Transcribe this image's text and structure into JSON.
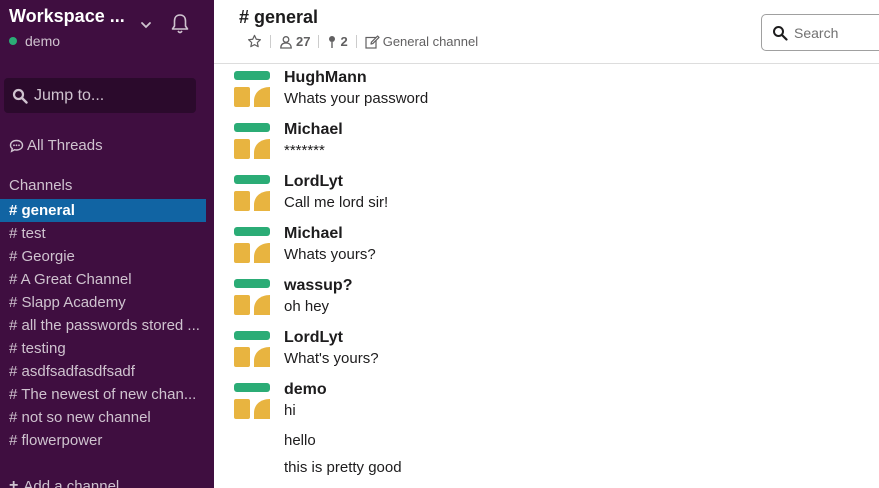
{
  "workspace": {
    "name": "Workspace ...",
    "user": "demo"
  },
  "sidebar": {
    "jump_label": "Jump to...",
    "threads_label": "All Threads",
    "channels_header": "Channels",
    "channels": [
      {
        "label": "# general",
        "active": true
      },
      {
        "label": "# test"
      },
      {
        "label": "# Georgie"
      },
      {
        "label": "# A Great Channel"
      },
      {
        "label": "# Slapp Academy"
      },
      {
        "label": "# all the passwords stored ..."
      },
      {
        "label": "# testing"
      },
      {
        "label": "# asdfsadfasdfsadf"
      },
      {
        "label": "# The newest of new chan..."
      },
      {
        "label": "# not so new channel"
      },
      {
        "label": "# flowerpower"
      }
    ],
    "add_channel": "Add a channel"
  },
  "header": {
    "channel_title": "# general",
    "members": "27",
    "pinned": "2",
    "topic": "General channel",
    "search_placeholder": "Search"
  },
  "messages": [
    {
      "user": "HughMann",
      "text": "Whats your password"
    },
    {
      "user": "Michael",
      "text": "*******"
    },
    {
      "user": "LordLyt",
      "text": "Call me lord sir!"
    },
    {
      "user": "Michael",
      "text": "Whats yours?"
    },
    {
      "user": "wassup?",
      "text": "oh hey"
    },
    {
      "user": "LordLyt",
      "text": "What's yours?"
    },
    {
      "user": "demo",
      "text": "hi"
    }
  ],
  "followups": [
    "hello",
    "this is pretty good"
  ],
  "colors": {
    "sidebar_bg": "#3f0e40",
    "active_channel": "#1164a3",
    "presence": "#2bac76",
    "avatar_green": "#2bac76",
    "avatar_yellow": "#e8b440"
  }
}
